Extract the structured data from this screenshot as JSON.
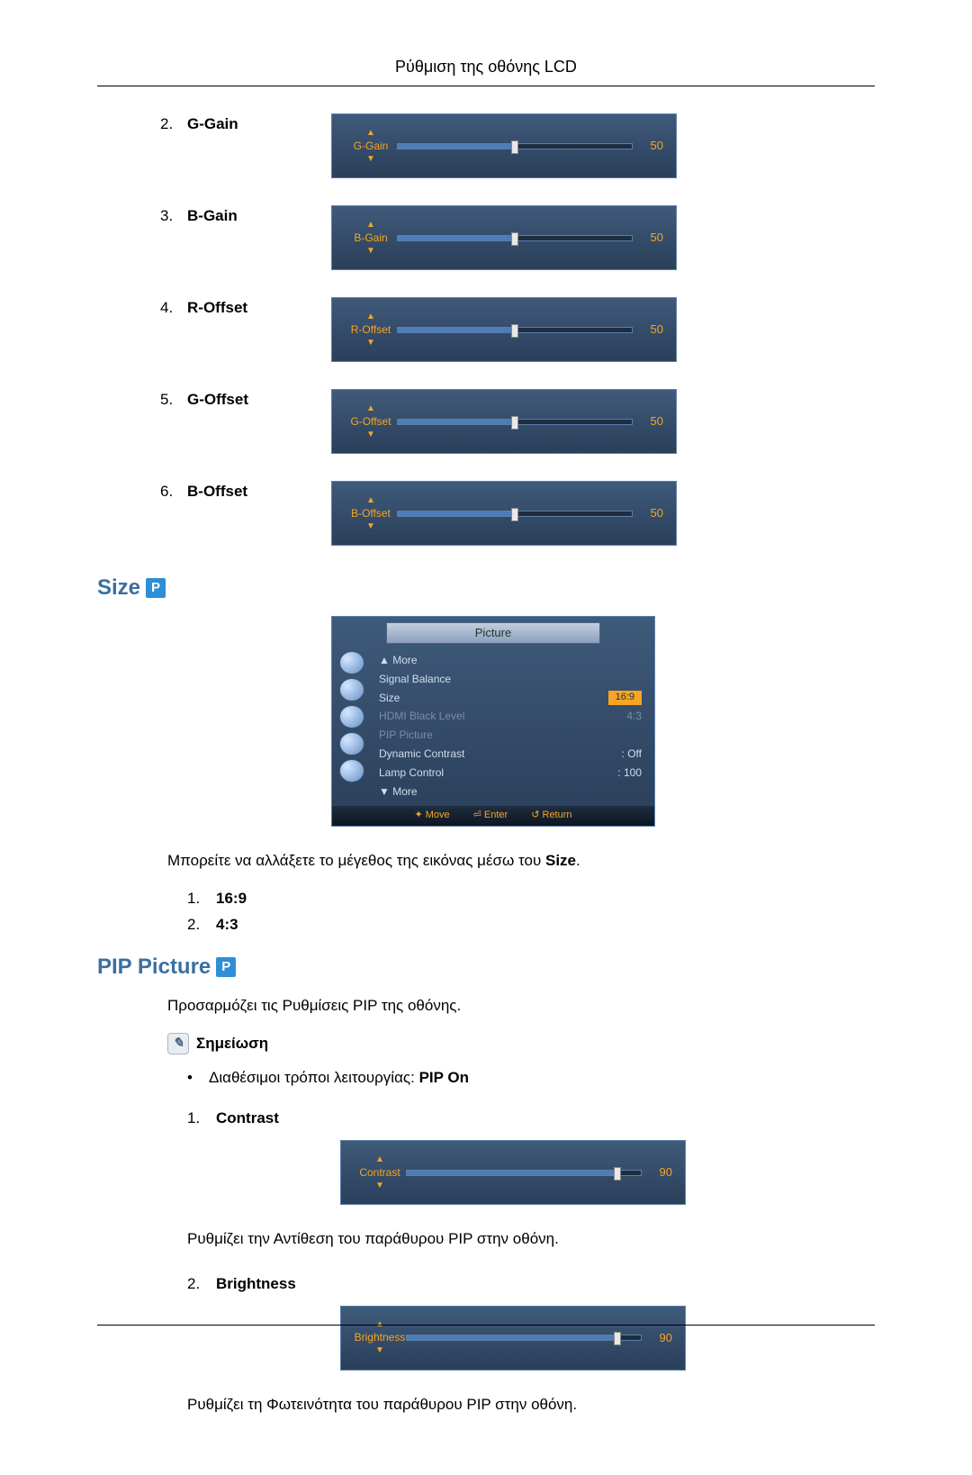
{
  "header": "Ρύθμιση της οθόνης LCD",
  "gains": [
    {
      "num": "2.",
      "label": "G-Gain",
      "slider_label": "G-Gain",
      "value": "50",
      "percent": 50
    },
    {
      "num": "3.",
      "label": "B-Gain",
      "slider_label": "B-Gain",
      "value": "50",
      "percent": 50
    },
    {
      "num": "4.",
      "label": "R-Offset",
      "slider_label": "R-Offset",
      "value": "50",
      "percent": 50
    },
    {
      "num": "5.",
      "label": "G-Offset",
      "slider_label": "G-Offset",
      "value": "50",
      "percent": 50
    },
    {
      "num": "6.",
      "label": "B-Offset",
      "slider_label": "B-Offset",
      "value": "50",
      "percent": 50
    }
  ],
  "size": {
    "title": "Size",
    "osd": {
      "title": "Picture",
      "items": [
        {
          "label": "▲ More",
          "value": ""
        },
        {
          "label": "Signal Balance",
          "value": ""
        },
        {
          "label": "Size",
          "value": "16:9",
          "selected": true
        },
        {
          "label": "HDMI Black Level",
          "value": "4:3",
          "dim": true
        },
        {
          "label": "PIP Picture",
          "value": "",
          "dim": true
        },
        {
          "label": "Dynamic Contrast",
          "value": ": Off"
        },
        {
          "label": "Lamp Control",
          "value": ": 100"
        },
        {
          "label": "▼ More",
          "value": ""
        }
      ],
      "footer": {
        "move": "Move",
        "enter": "Enter",
        "return": "Return"
      }
    },
    "desc_pre": "Μπορείτε να αλλάξετε το μέγεθος της εικόνας μέσω του ",
    "desc_bold": "Size",
    "desc_post": ".",
    "options": [
      {
        "num": "1.",
        "label": "16:9"
      },
      {
        "num": "2.",
        "label": "4:3"
      }
    ]
  },
  "pip": {
    "title": "PIP Picture",
    "intro": "Προσαρμόζει τις Ρυθμίσεις PIP της οθόνης.",
    "note_label": "Σημείωση",
    "mode_pre": "Διαθέσιμοι τρόποι λειτουργίας: ",
    "mode_bold": "PIP On",
    "items": [
      {
        "num": "1.",
        "label": "Contrast",
        "slider_label": "Contrast",
        "value": "90",
        "percent": 90,
        "desc": "Ρυθμίζει την Αντίθεση του παράθυρου PIP στην οθόνη."
      },
      {
        "num": "2.",
        "label": "Brightness",
        "slider_label": "Brightness",
        "value": "90",
        "percent": 90,
        "desc": "Ρυθμίζει τη Φωτεινότητα του παράθυρου PIP στην οθόνη."
      }
    ]
  }
}
